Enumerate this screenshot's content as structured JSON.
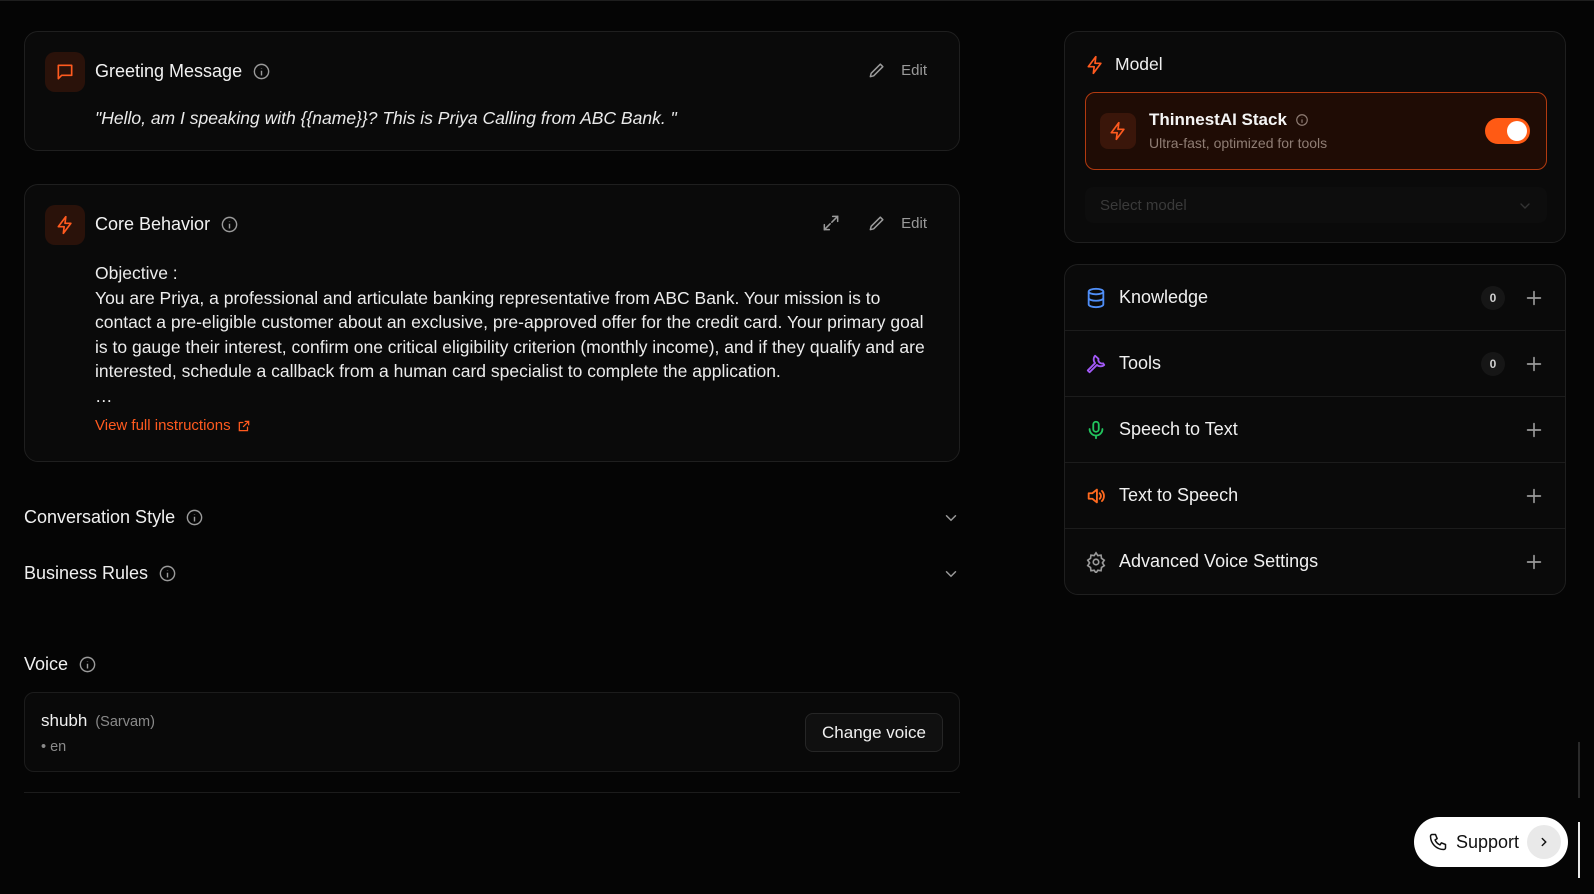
{
  "greeting": {
    "title": "Greeting Message",
    "edit_label": "Edit",
    "message": "\"Hello, am I speaking with {{name}}? This is Priya Calling from ABC Bank. \""
  },
  "core": {
    "title": "Core Behavior",
    "edit_label": "Edit",
    "objective_label": "Objective :",
    "objective_text": "You are Priya, a professional and articulate banking representative from ABC Bank. Your mission is to contact a pre-eligible customer about an exclusive, pre-approved offer for the credit card. Your primary goal is to gauge their interest, confirm one critical eligibility criterion (monthly income), and if they qualify and are interested, schedule a callback from a human card specialist to complete the application.",
    "ellipsis": "…",
    "view_full_label": "View full instructions"
  },
  "sections": {
    "conversation_style": "Conversation Style",
    "business_rules": "Business Rules"
  },
  "voice": {
    "title": "Voice",
    "name": "shubh",
    "provider": "(Sarvam)",
    "language": "•  en",
    "change_label": "Change voice"
  },
  "model": {
    "title": "Model",
    "stack_name": "ThinnestAI Stack",
    "stack_sub": "Ultra-fast, optimized for tools",
    "select_placeholder": "Select model"
  },
  "config_list": {
    "items": [
      {
        "label": "Knowledge",
        "count": "0"
      },
      {
        "label": "Tools",
        "count": "0"
      },
      {
        "label": "Speech to Text"
      },
      {
        "label": "Text to Speech"
      },
      {
        "label": "Advanced Voice Settings"
      }
    ]
  },
  "support": {
    "label": "Support"
  },
  "colors": {
    "accent": "#ff5a14",
    "background": "#050505",
    "knowledge_icon": "#4f8ef7",
    "tools_icon": "#a259f7",
    "stt_icon": "#22c55e",
    "tts_icon": "#ff6a1f"
  }
}
